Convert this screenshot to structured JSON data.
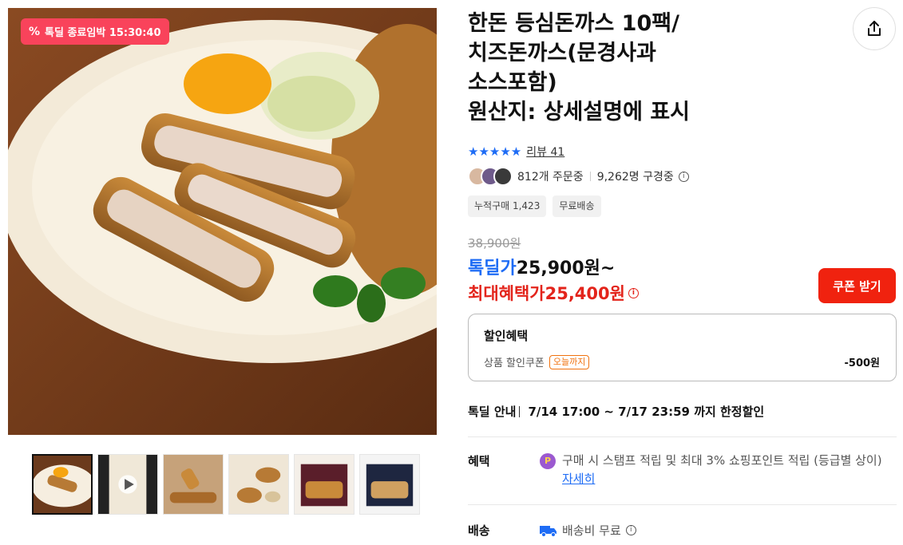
{
  "deal_badge": {
    "icon": "percent-icon",
    "text": "톡딜 종료임박 15:30:40"
  },
  "product": {
    "title": "한돈 등심돈까스 10팩/\n치즈돈까스(문경사과\n소스포함)\n원산지: 상세설명에 표시"
  },
  "rating": {
    "stars": "★★★★★",
    "review_text": "리뷰 41"
  },
  "stats": {
    "orders": "812개 주문중",
    "viewers": "9,262명 구경중"
  },
  "tags": [
    "누적구매 1,423",
    "무료배송"
  ],
  "price": {
    "original": "38,900원",
    "deal_label": "톡딜가",
    "deal_value": "25,900원~",
    "max_label": "최대혜택가",
    "max_value": "25,400원",
    "coupon_button": "쿠폰 받기"
  },
  "discount": {
    "heading": "할인혜택",
    "item_label": "상품 할인쿠폰",
    "item_chip": "오늘까지",
    "item_amount": "-500원"
  },
  "deal_guide": {
    "label": "톡딜 안내",
    "value": "7/14 17:00 ~ 7/17 23:59 까지 한정할인"
  },
  "benefit": {
    "label": "혜택",
    "icon_letter": "P",
    "text": "구매 시 스탬프 적립 및 최대 3% 쇼핑포인트 적립 (등급별 상이)",
    "link": "자세히"
  },
  "shipping": {
    "label": "배송",
    "text": "배송비 무료"
  },
  "colors": {
    "deal_blue": "#1e6cf5",
    "price_red": "#e3241b",
    "badge_pink": "#f9435b",
    "coupon_red": "#f0220f"
  }
}
